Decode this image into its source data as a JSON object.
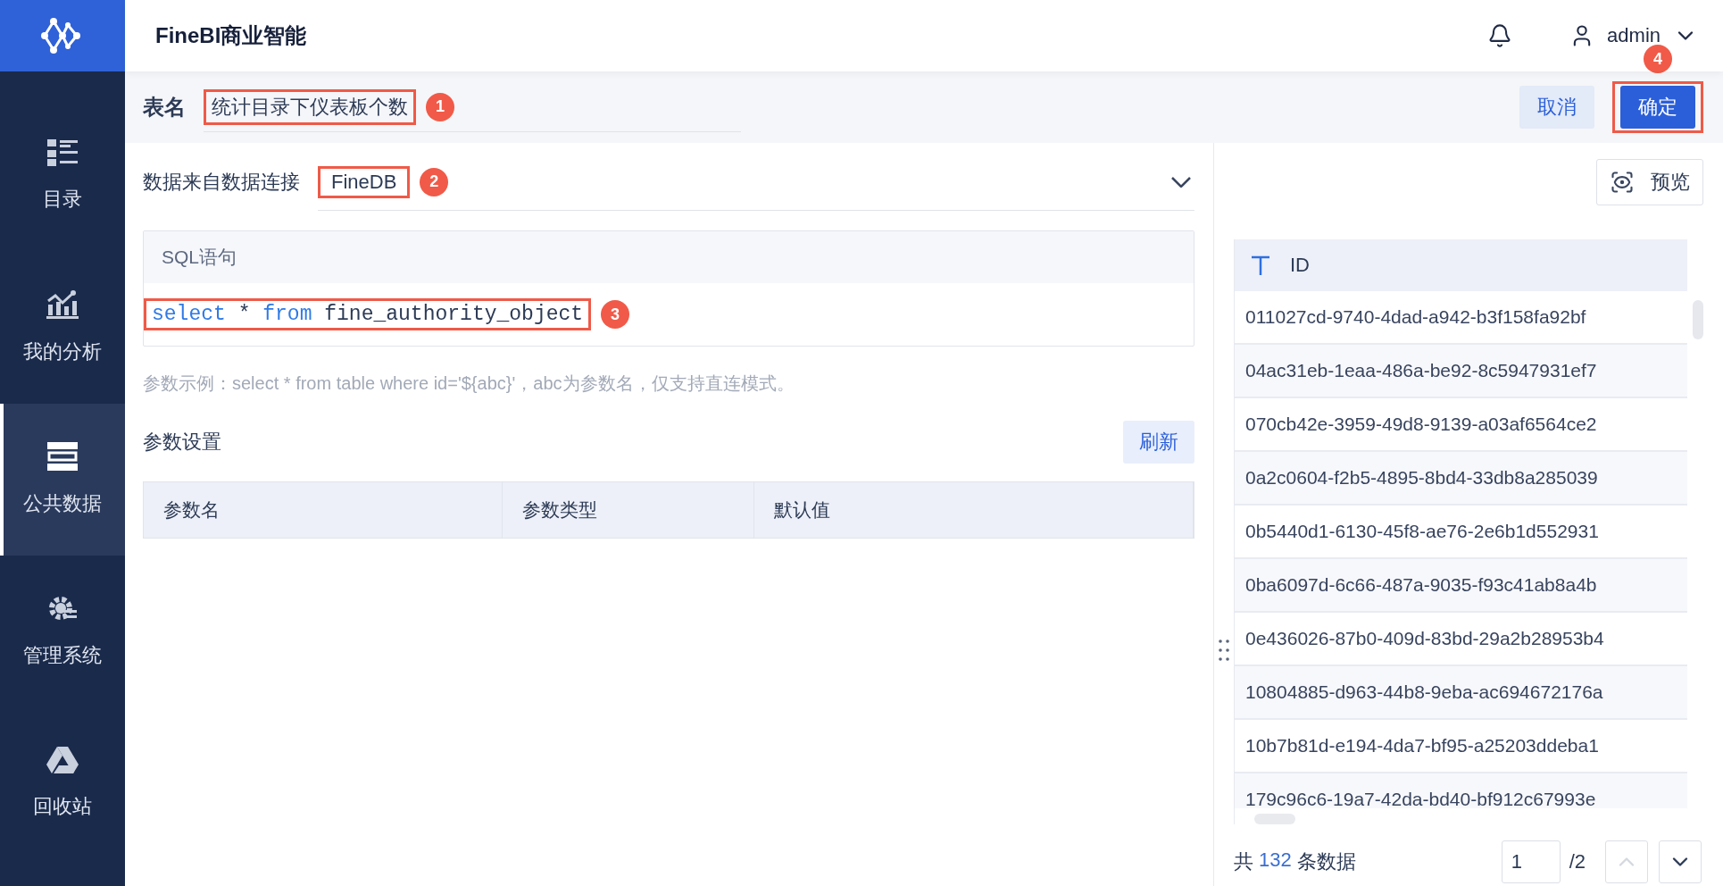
{
  "app": {
    "title": "FineBI商业智能",
    "user": "admin"
  },
  "sidebar": {
    "items": [
      {
        "label": "目录",
        "selected": false
      },
      {
        "label": "我的分析",
        "selected": false
      },
      {
        "label": "公共数据",
        "selected": true
      },
      {
        "label": "管理系统",
        "selected": false
      },
      {
        "label": "回收站",
        "selected": false
      }
    ]
  },
  "table_name": {
    "label": "表名",
    "value": "统计目录下仪表板个数",
    "annotation": "1"
  },
  "actions": [
    {
      "label": "取消",
      "kind": "secondary"
    },
    {
      "label": "确定",
      "kind": "primary",
      "annotation": "4"
    }
  ],
  "connection": {
    "label": "数据来自数据连接",
    "value": "FineDB",
    "annotation": "2"
  },
  "sql": {
    "header": "SQL语句",
    "annotation": "3",
    "tokens": [
      {
        "text": "select ",
        "kind": "keyword"
      },
      {
        "text": "* ",
        "kind": "plain"
      },
      {
        "text": "from ",
        "kind": "keyword"
      },
      {
        "text": "fine_authority_object",
        "kind": "plain"
      }
    ]
  },
  "hint": "参数示例：select * from table where id='${abc}'，abc为参数名，仅支持直连模式。",
  "params": {
    "title": "参数设置",
    "refresh": "刷新",
    "columns": [
      "参数名",
      "参数类型",
      "默认值"
    ]
  },
  "preview": {
    "button": "预览",
    "column": "ID",
    "rows": [
      "011027cd-9740-4dad-a942-b3f158fa92bf",
      "04ac31eb-1eaa-486a-be92-8c5947931ef7",
      "070cb42e-3959-49d8-9139-a03af6564ce2",
      "0a2c0604-f2b5-4895-8bd4-33db8a285039",
      "0b5440d1-6130-45f8-ae76-2e6b1d552931",
      "0ba6097d-6c66-487a-9035-f93c41ab8a4b",
      "0e436026-87b0-409d-83bd-29a2b28953b4",
      "10804885-d963-44b8-9eba-ac694672176a",
      "10b7b81d-e194-4da7-bf95-a25203ddeba1",
      "179c96c6-19a7-42da-bd40-bf912c67993e"
    ]
  },
  "pagination": {
    "prefix": "共",
    "count": "132",
    "suffix": "条数据",
    "page": "1",
    "total": "/2",
    "prev_disabled": true,
    "next_disabled": false
  }
}
